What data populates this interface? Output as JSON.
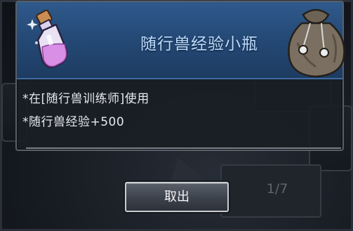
{
  "item": {
    "name": "随行兽经验小瓶",
    "icon": "potion-bottle-icon",
    "side_icon": "pouch-icon",
    "description": [
      "*在[随行兽训练师]使用",
      "*随行兽经验+500"
    ]
  },
  "actions": {
    "take_out_label": "取出"
  },
  "pagination": {
    "label": "1/7"
  },
  "colors": {
    "header_blue": "#2f5a8c",
    "item_name": "#bcdcff",
    "potion_liquid": "#d98fe6"
  }
}
